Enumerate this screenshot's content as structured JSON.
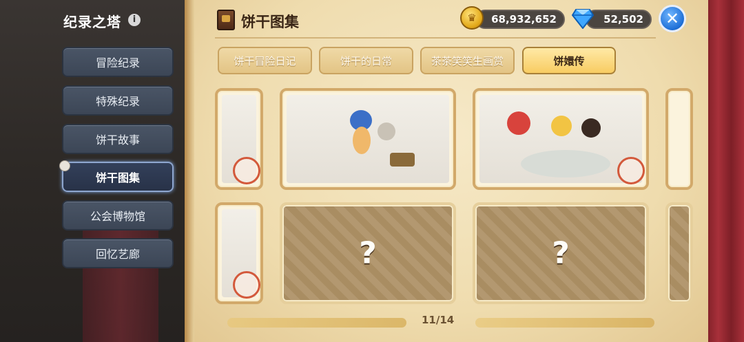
{
  "sidebar": {
    "title": "纪录之塔",
    "items": [
      {
        "label": "冒险纪录"
      },
      {
        "label": "特殊纪录"
      },
      {
        "label": "饼干故事"
      },
      {
        "label": "饼干图集"
      },
      {
        "label": "公会博物馆"
      },
      {
        "label": "回忆艺廊"
      }
    ],
    "active_index": 3
  },
  "header": {
    "title": "饼干图集",
    "coins": "68,932,652",
    "gems": "52,502"
  },
  "tabs": [
    {
      "label": "饼干冒险日记"
    },
    {
      "label": "饼干的日常"
    },
    {
      "label": "茶茶笑笑生画赏"
    },
    {
      "label": "饼嬛传"
    }
  ],
  "active_tab": 3,
  "gallery": {
    "locked_symbol": "?",
    "page": "11/14"
  },
  "colors": {
    "accent_gold": "#f8cc62",
    "nav_blue": "#3c4656",
    "close_blue": "#1e6fd6"
  }
}
